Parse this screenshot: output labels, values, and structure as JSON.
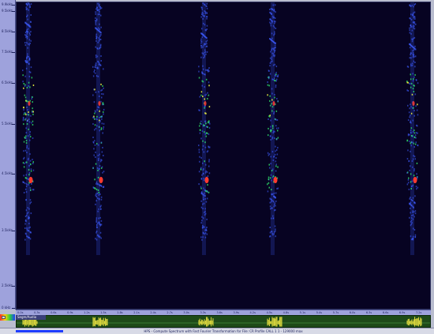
{
  "frequency_axis": {
    "ticks": [
      "9.9kHz",
      "9.5kHz",
      "8.5kHz",
      "7.5kHz",
      "6.5kHz",
      "5.5kHz",
      "4.5kHz",
      "3.5kHz",
      "2.5kHz",
      "0 kHz"
    ]
  },
  "time_axis": {
    "ticks": [
      "0.0s",
      "0.3s",
      "0.6s",
      "0.9s",
      "1.2s",
      "1.5s",
      "1.8s",
      "2.1s",
      "2.4s",
      "2.7s",
      "3.0s",
      "3.3s",
      "3.6s",
      "3.9s",
      "4.2s",
      "4.5s",
      "4.8s",
      "5.1s",
      "5.4s",
      "5.7s",
      "6.0s",
      "6.3s",
      "6.6s",
      "6.9s",
      "7.2s"
    ]
  },
  "waveform": {
    "header": "Segm/Audio"
  },
  "status": {
    "text": "HPS - Compute Spectrum with Fast Fourier Transformation for File: CR Profile CALL 1 1 - 129000 max"
  },
  "colors": {
    "background": "#070322",
    "axis": "#9ea2dc",
    "waveform_bg": "#1e4a18",
    "waveform_signal": "#e8e040",
    "peak": "#ff3b2f",
    "high": "#eaf040",
    "mid": "#2ee06a",
    "low": "#3d5cff"
  }
}
